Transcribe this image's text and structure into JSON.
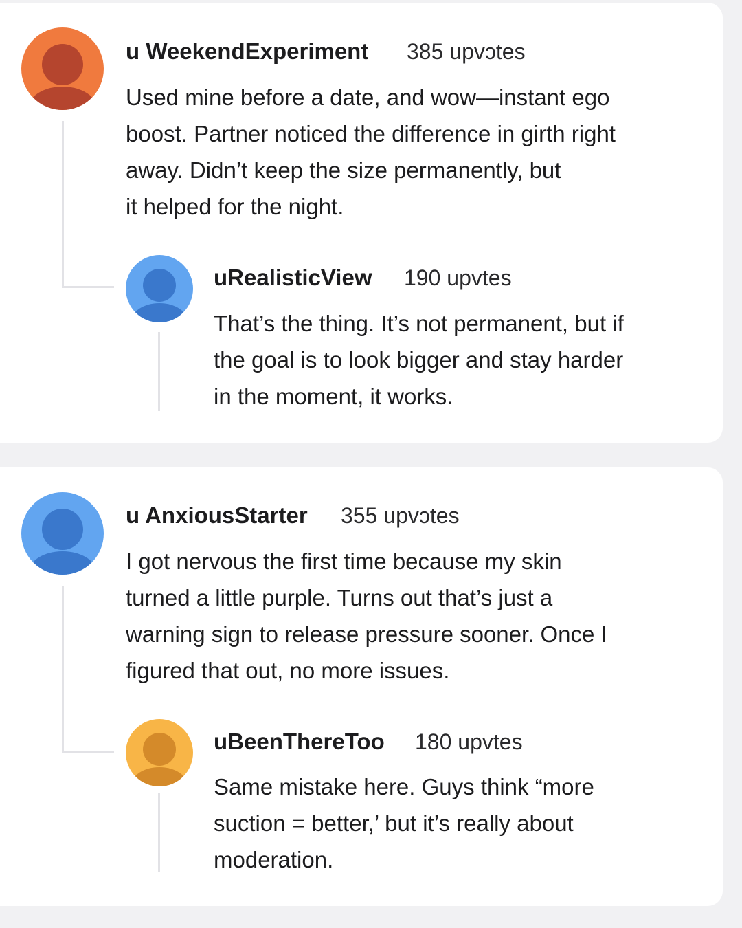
{
  "threads": [
    {
      "comment": {
        "username": "u WeekendExperiment",
        "upvotes": "385 upvɔtes",
        "avatar_color": "#f07a3e",
        "avatar_figure_color": "#b5452e",
        "text_lines": [
          "Used mine before a date, and wow—instant ego",
          "boost. Partner noticed the difference in girth right",
          "away. Didn’t keep the size permanently, but",
          "it helped for the night."
        ]
      },
      "reply": {
        "username": "uRealisticView",
        "upvotes": "190 upvtes",
        "avatar_color": "#62a5f0",
        "avatar_figure_color": "#3a78cc",
        "text_lines": [
          "That’s the thing. It’s not permanent, but if",
          "the goal is to look bigger and stay harder",
          "in the moment, it works."
        ]
      }
    },
    {
      "comment": {
        "username": "u AnxiousStarter",
        "upvotes": "355 upvɔtes",
        "avatar_color": "#62a5f0",
        "avatar_figure_color": "#3a78cc",
        "text_lines": [
          "I got nervous the first time because my skin",
          "turned a little purple. Turns out that’s just a",
          "warning sign to release pressure sooner. Once I",
          "figured that out, no more issues."
        ]
      },
      "reply": {
        "username": "uBeenThereToo",
        "upvotes": "180 upvtes",
        "avatar_color": "#f8b547",
        "avatar_figure_color": "#d48a2a",
        "text_lines": [
          "Same mistake here. Guys think “more",
          "suction = better,’ but it’s really about",
          "moderation."
        ]
      }
    }
  ]
}
